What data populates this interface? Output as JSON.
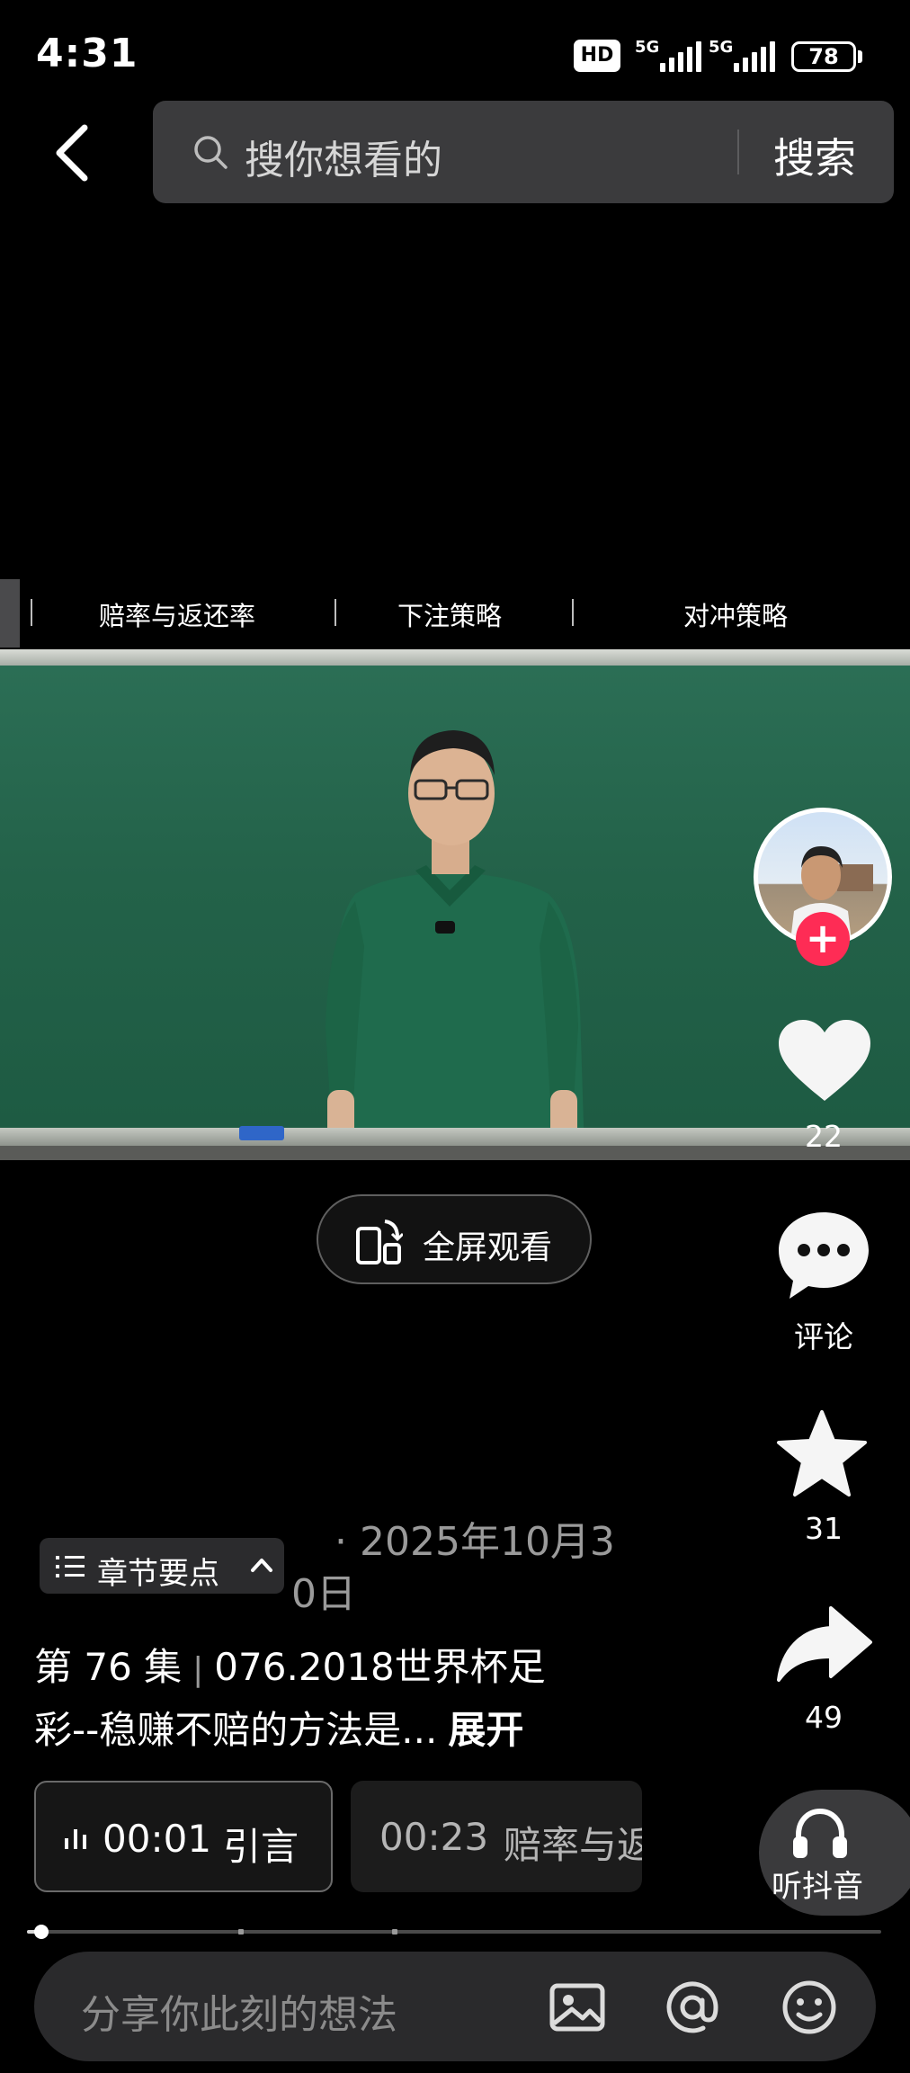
{
  "status_bar": {
    "time": "4:31",
    "hd_label": "HD",
    "sim1_label": "5G",
    "sim2_label": "5G",
    "battery": "78"
  },
  "header": {
    "search_placeholder": "搜你想看的",
    "search_button": "搜索"
  },
  "chapters": {
    "items": [
      "赔率与返还率",
      "下注策略",
      "对冲策略"
    ]
  },
  "actions": {
    "likes": "22",
    "comment_label": "评论",
    "favorites": "31",
    "shares": "49"
  },
  "fullscreen": {
    "label": "全屏观看"
  },
  "description": {
    "chapter_chip": "章节要点",
    "date": "· 2025年10月30日",
    "episode": "第 76 集",
    "title_line1": "076.2018世界杯足",
    "title_line2": "彩--稳赚不赔的方法是...",
    "expand": "展开"
  },
  "segments": [
    {
      "time": "00:01",
      "title": "引言",
      "active": true
    },
    {
      "time": "00:23",
      "title": "赔率与返",
      "active": false
    }
  ],
  "listen": {
    "label": "听抖音"
  },
  "progress": {
    "played_fraction": 0.017,
    "chapter_marks": [
      0.25,
      0.43
    ]
  },
  "comment": {
    "placeholder": "分享你此刻的想法"
  },
  "colors": {
    "follow": "#fe2c55",
    "board": "#236249",
    "panel": "#2a2a2c"
  }
}
